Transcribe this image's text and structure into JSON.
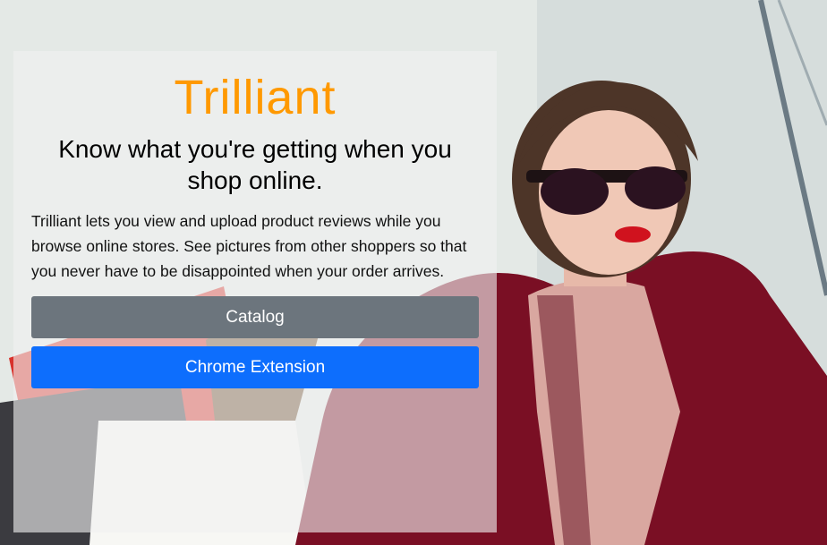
{
  "hero": {
    "background_image": "woman-with-shopping-bags-photo"
  },
  "panel": {
    "brand": "Trilliant",
    "tagline": "Know what you're getting when you shop online.",
    "description": "Trilliant lets you view and upload product reviews while you browse online stores. See pictures from other shoppers so that you never have to be disappointed when your order arrives."
  },
  "actions": {
    "catalog_label": "Catalog",
    "extension_label": "Chrome Extension"
  },
  "colors": {
    "brand": "#ff9900",
    "catalog_button": "#6c757d",
    "extension_button": "#0d6efd"
  }
}
